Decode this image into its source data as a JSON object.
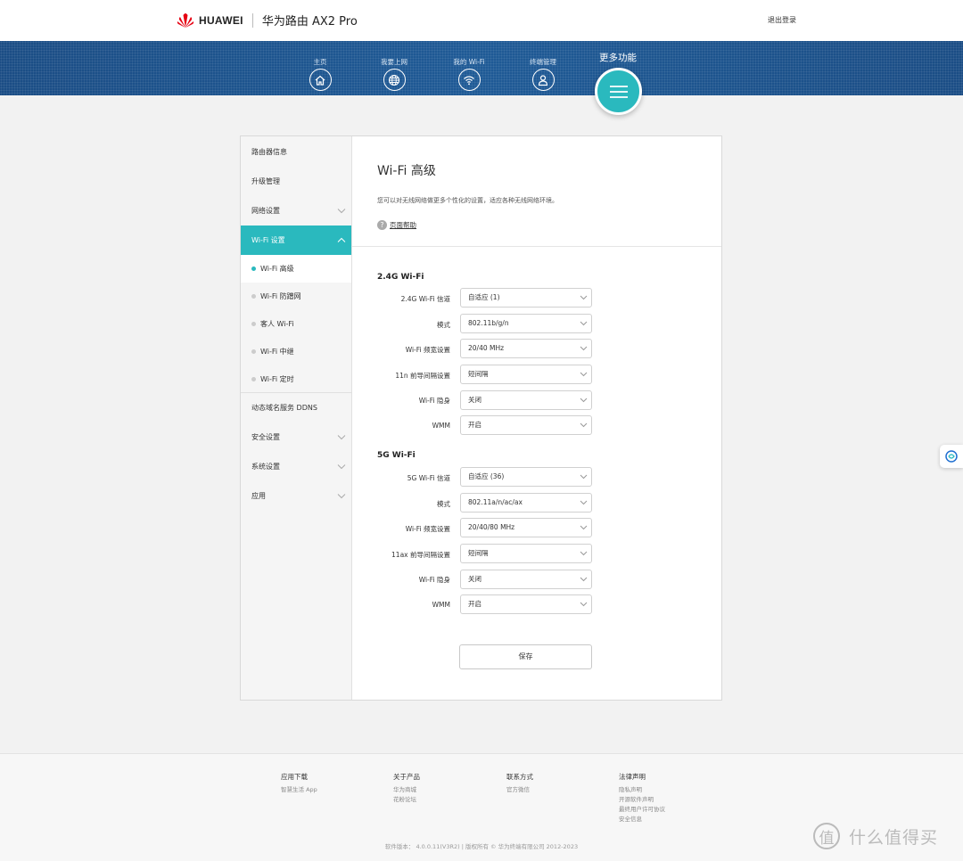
{
  "header": {
    "brand": "HUAWEI",
    "product": "华为路由 AX2 Pro",
    "logout": "退出登录"
  },
  "nav": {
    "items": [
      {
        "label": "主页",
        "icon": "home-icon"
      },
      {
        "label": "我要上网",
        "icon": "globe-icon"
      },
      {
        "label": "我的 Wi-Fi",
        "icon": "wifi-icon"
      },
      {
        "label": "终端管理",
        "icon": "user-icon"
      }
    ],
    "more": {
      "label": "更多功能",
      "icon": "menu-icon"
    }
  },
  "sidebar": {
    "items": [
      {
        "label": "路由器信息"
      },
      {
        "label": "升级管理"
      },
      {
        "label": "网络设置"
      },
      {
        "label": "Wi-Fi 设置"
      },
      {
        "label": "动态域名服务 DDNS"
      },
      {
        "label": "安全设置"
      },
      {
        "label": "系统设置"
      },
      {
        "label": "应用"
      }
    ],
    "subitems": [
      {
        "label": "Wi-Fi 高级"
      },
      {
        "label": "Wi-Fi 防蹭网"
      },
      {
        "label": "客人 Wi-Fi"
      },
      {
        "label": "Wi-Fi 中继"
      },
      {
        "label": "Wi-Fi 定时"
      }
    ]
  },
  "content": {
    "title": "Wi-Fi 高级",
    "description": "您可以对无线网络做更多个性化的设置，适应各种无线网络环境。",
    "help": "页面帮助",
    "sections": [
      {
        "title": "2.4G Wi-Fi",
        "rows": [
          {
            "label": "2.4G Wi-Fi 信道",
            "value": "自适应 (1)"
          },
          {
            "label": "模式",
            "value": "802.11b/g/n"
          },
          {
            "label": "Wi-Fi 频宽设置",
            "value": "20/40 MHz"
          },
          {
            "label": "11n 前导间隔设置",
            "value": "短间隔"
          },
          {
            "label": "Wi-Fi 隐身",
            "value": "关闭"
          },
          {
            "label": "WMM",
            "value": "开启"
          }
        ]
      },
      {
        "title": "5G Wi-Fi",
        "rows": [
          {
            "label": "5G Wi-Fi 信道",
            "value": "自适应 (36)"
          },
          {
            "label": "模式",
            "value": "802.11a/n/ac/ax"
          },
          {
            "label": "Wi-Fi 频宽设置",
            "value": "20/40/80 MHz"
          },
          {
            "label": "11ax 前导间隔设置",
            "value": "短间隔"
          },
          {
            "label": "Wi-Fi 隐身",
            "value": "关闭"
          },
          {
            "label": "WMM",
            "value": "开启"
          }
        ]
      }
    ],
    "save": "保存"
  },
  "footer": {
    "columns": [
      {
        "title": "应用下载",
        "links": [
          "智慧生活 App"
        ]
      },
      {
        "title": "关于产品",
        "links": [
          "华为商城",
          "花粉论坛"
        ]
      },
      {
        "title": "联系方式",
        "links": [
          "官方微信"
        ]
      },
      {
        "title": "法律声明",
        "links": [
          "隐私声明",
          "开源软件声明",
          "最终用户许可协议",
          "安全信息"
        ]
      }
    ],
    "copyright": "软件版本： 4.0.0.11(V3R2) | 版权所有 © 华为终端有限公司 2012-2023"
  },
  "watermark": {
    "text": "什么值得买",
    "icon_char": "值"
  },
  "colors": {
    "accent": "#2ab9be",
    "nav_bg": "#1f5a96"
  }
}
